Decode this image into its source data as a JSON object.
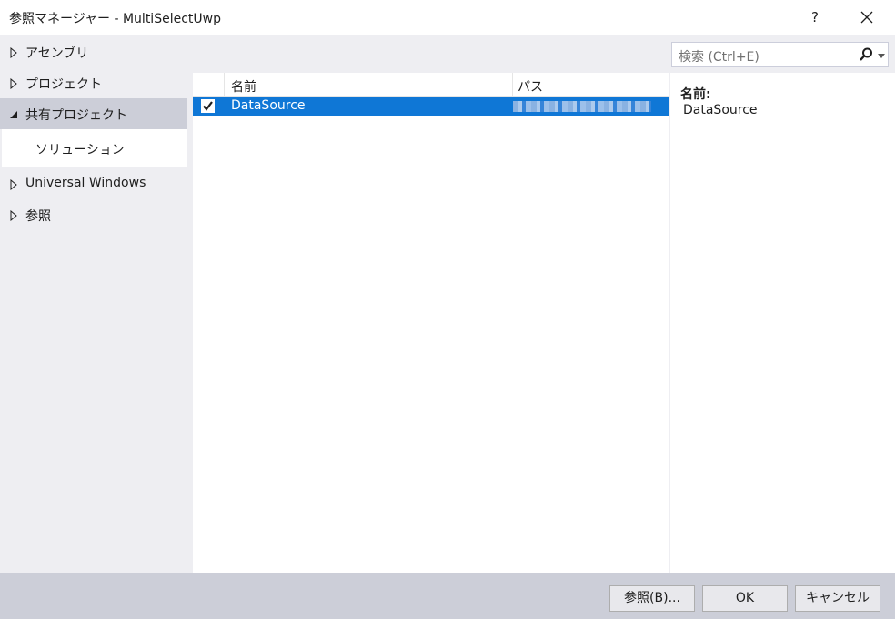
{
  "window": {
    "title": "参照マネージャー - MultiSelectUwp",
    "help": "?"
  },
  "sidebar": {
    "items": [
      {
        "label": "アセンブリ"
      },
      {
        "label": "プロジェクト"
      },
      {
        "label": "共有プロジェクト"
      },
      {
        "label": "ソリューション"
      },
      {
        "label": "Universal Windows"
      },
      {
        "label": "参照"
      }
    ]
  },
  "search": {
    "placeholder": "検索 (Ctrl+E)"
  },
  "grid": {
    "columns": [
      "名前",
      "パス"
    ],
    "rows": [
      {
        "checked": true,
        "name": "DataSource",
        "path": ""
      }
    ]
  },
  "details": {
    "name_label": "名前:",
    "name_value": "DataSource"
  },
  "footer": {
    "browse": "参照(B)...",
    "ok": "OK",
    "cancel": "キャンセル"
  },
  "colors": {
    "selection": "#0f77d6",
    "nav_selected": "#ccced8",
    "background": "#eeeef2"
  }
}
